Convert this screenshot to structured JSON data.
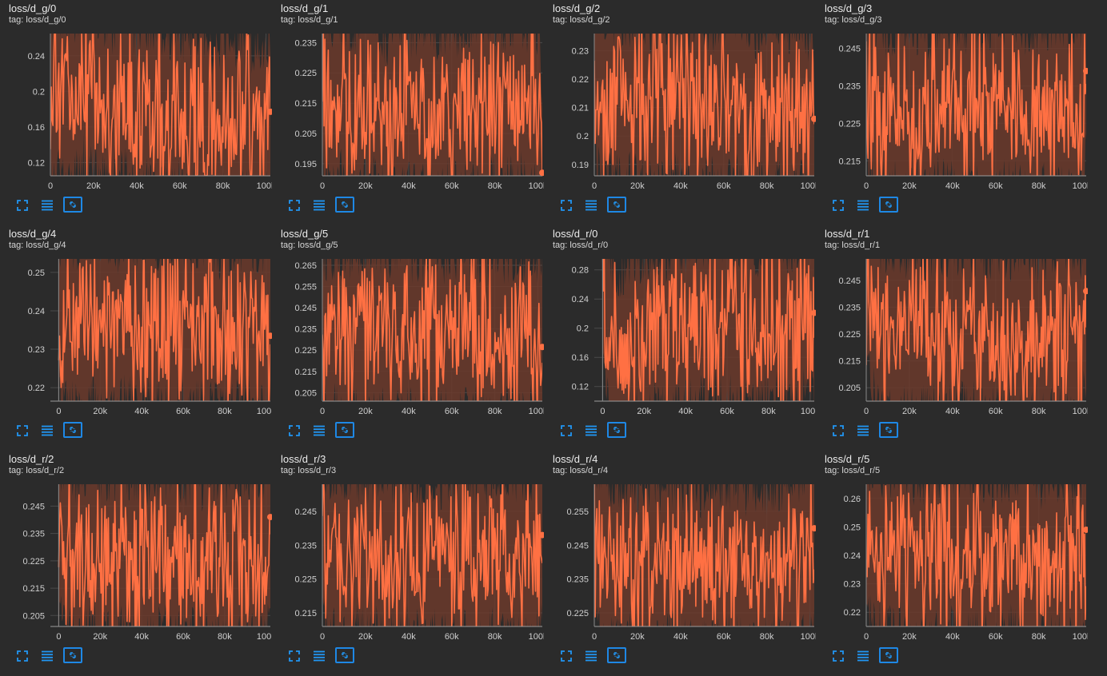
{
  "colors": {
    "background": "#2b2b2b",
    "series": "#ff7043",
    "band": "#6b3a2c",
    "grid": "#4a4a4a",
    "axis": "#9e9e9e",
    "toolbar": "#2196f3"
  },
  "toolbar_icons": [
    "fullscreen-icon",
    "toggle-log-scale-icon",
    "fit-domain-icon"
  ],
  "chart_data": [
    {
      "title": "loss/d_g/0",
      "tag": "tag: loss/d_g/0",
      "type": "line",
      "xlim": [
        0,
        102000
      ],
      "ylim": [
        0.105,
        0.265
      ],
      "xticks": [
        0,
        20000,
        40000,
        60000,
        80000,
        100000
      ],
      "xticklabels": [
        "0",
        "20k",
        "40k",
        "60k",
        "80k",
        "100k"
      ],
      "yticks": [
        0.12,
        0.16,
        0.2,
        0.24
      ],
      "yticklabels": [
        "0.12",
        "0.16",
        "0.2",
        "0.24"
      ],
      "series": [
        {
          "x": [
            0,
            5000,
            10000,
            15000,
            20000,
            25000,
            30000,
            35000,
            40000,
            45000,
            50000,
            55000,
            60000,
            65000,
            70000,
            75000,
            80000,
            85000,
            90000,
            95000,
            100000,
            102000
          ],
          "y": [
            0.18,
            0.2,
            0.19,
            0.21,
            0.2,
            0.19,
            0.18,
            0.2,
            0.17,
            0.19,
            0.18,
            0.17,
            0.18,
            0.17,
            0.18,
            0.16,
            0.17,
            0.16,
            0.17,
            0.16,
            0.17,
            0.177
          ]
        }
      ]
    },
    {
      "title": "loss/d_g/1",
      "tag": "tag: loss/d_g/1",
      "type": "line",
      "xlim": [
        0,
        102000
      ],
      "ylim": [
        0.191,
        0.238
      ],
      "xticks": [
        0,
        20000,
        40000,
        60000,
        80000,
        100000
      ],
      "xticklabels": [
        "0",
        "20k",
        "40k",
        "60k",
        "80k",
        "100k"
      ],
      "yticks": [
        0.195,
        0.205,
        0.215,
        0.225,
        0.235
      ],
      "yticklabels": [
        "0.195",
        "0.205",
        "0.215",
        "0.225",
        "0.235"
      ],
      "series": [
        {
          "x": [
            0,
            5000,
            10000,
            15000,
            20000,
            25000,
            30000,
            35000,
            40000,
            45000,
            50000,
            55000,
            60000,
            65000,
            70000,
            75000,
            80000,
            85000,
            90000,
            95000,
            100000,
            102000
          ],
          "y": [
            0.22,
            0.215,
            0.218,
            0.212,
            0.216,
            0.214,
            0.21,
            0.215,
            0.212,
            0.214,
            0.211,
            0.213,
            0.214,
            0.212,
            0.215,
            0.213,
            0.216,
            0.214,
            0.217,
            0.215,
            0.213,
            0.192
          ]
        }
      ]
    },
    {
      "title": "loss/d_g/2",
      "tag": "tag: loss/d_g/2",
      "type": "line",
      "xlim": [
        0,
        102000
      ],
      "ylim": [
        0.186,
        0.236
      ],
      "xticks": [
        0,
        20000,
        40000,
        60000,
        80000,
        100000
      ],
      "xticklabels": [
        "0",
        "20k",
        "40k",
        "60k",
        "80k",
        "100k"
      ],
      "yticks": [
        0.19,
        0.2,
        0.21,
        0.22,
        0.23
      ],
      "yticklabels": [
        "0.19",
        "0.2",
        "0.21",
        "0.22",
        "0.23"
      ],
      "series": [
        {
          "x": [
            0,
            5000,
            10000,
            15000,
            20000,
            25000,
            30000,
            35000,
            40000,
            45000,
            50000,
            55000,
            60000,
            65000,
            70000,
            75000,
            80000,
            85000,
            90000,
            95000,
            100000,
            102000
          ],
          "y": [
            0.22,
            0.215,
            0.214,
            0.212,
            0.213,
            0.21,
            0.212,
            0.211,
            0.213,
            0.21,
            0.212,
            0.211,
            0.21,
            0.213,
            0.21,
            0.209,
            0.212,
            0.21,
            0.209,
            0.211,
            0.208,
            0.206
          ]
        }
      ]
    },
    {
      "title": "loss/d_g/3",
      "tag": "tag: loss/d_g/3",
      "type": "line",
      "xlim": [
        0,
        102000
      ],
      "ylim": [
        0.211,
        0.249
      ],
      "xticks": [
        0,
        20000,
        40000,
        60000,
        80000,
        100000
      ],
      "xticklabels": [
        "0",
        "20k",
        "40k",
        "60k",
        "80k",
        "100k"
      ],
      "yticks": [
        0.215,
        0.225,
        0.235,
        0.245
      ],
      "yticklabels": [
        "0.215",
        "0.225",
        "0.235",
        "0.245"
      ],
      "series": [
        {
          "x": [
            0,
            5000,
            10000,
            15000,
            20000,
            25000,
            30000,
            35000,
            40000,
            45000,
            50000,
            55000,
            60000,
            65000,
            70000,
            75000,
            80000,
            85000,
            90000,
            95000,
            100000,
            102000
          ],
          "y": [
            0.232,
            0.23,
            0.228,
            0.231,
            0.229,
            0.23,
            0.228,
            0.232,
            0.23,
            0.229,
            0.231,
            0.228,
            0.23,
            0.229,
            0.23,
            0.227,
            0.229,
            0.228,
            0.229,
            0.228,
            0.231,
            0.239
          ]
        }
      ]
    },
    {
      "title": "loss/d_g/4",
      "tag": "tag: loss/d_g/4",
      "type": "line",
      "xlim": [
        -4000,
        102000
      ],
      "ylim": [
        0.2165,
        0.2535
      ],
      "xticks": [
        0,
        20000,
        40000,
        60000,
        80000,
        100000
      ],
      "xticklabels": [
        "0",
        "20k",
        "40k",
        "60k",
        "80k",
        "100k"
      ],
      "yticks": [
        0.22,
        0.23,
        0.24,
        0.25
      ],
      "yticklabels": [
        "0.22",
        "0.23",
        "0.24",
        "0.25"
      ],
      "series": [
        {
          "x": [
            0,
            5000,
            10000,
            15000,
            20000,
            25000,
            30000,
            35000,
            40000,
            45000,
            50000,
            55000,
            60000,
            65000,
            70000,
            75000,
            80000,
            85000,
            90000,
            95000,
            100000,
            102000
          ],
          "y": [
            0.237,
            0.238,
            0.236,
            0.239,
            0.235,
            0.237,
            0.236,
            0.238,
            0.235,
            0.237,
            0.236,
            0.234,
            0.236,
            0.235,
            0.237,
            0.236,
            0.234,
            0.236,
            0.237,
            0.235,
            0.236,
            0.2335
          ]
        }
      ]
    },
    {
      "title": "loss/d_g/5",
      "tag": "tag: loss/d_g/5",
      "type": "line",
      "xlim": [
        0,
        102000
      ],
      "ylim": [
        0.201,
        0.268
      ],
      "xticks": [
        0,
        20000,
        40000,
        60000,
        80000,
        100000
      ],
      "xticklabels": [
        "0",
        "20k",
        "40k",
        "60k",
        "80k",
        "100k"
      ],
      "yticks": [
        0.205,
        0.215,
        0.225,
        0.235,
        0.245,
        0.255,
        0.265
      ],
      "yticklabels": [
        "0.205",
        "0.215",
        "0.225",
        "0.235",
        "0.245",
        "0.255",
        "0.265"
      ],
      "series": [
        {
          "x": [
            0,
            5000,
            10000,
            15000,
            20000,
            25000,
            30000,
            35000,
            40000,
            45000,
            50000,
            55000,
            60000,
            65000,
            70000,
            75000,
            80000,
            85000,
            90000,
            95000,
            100000,
            102000
          ],
          "y": [
            0.232,
            0.234,
            0.23,
            0.233,
            0.231,
            0.234,
            0.232,
            0.236,
            0.233,
            0.232,
            0.235,
            0.231,
            0.233,
            0.232,
            0.234,
            0.231,
            0.233,
            0.232,
            0.231,
            0.233,
            0.232,
            0.2265
          ]
        }
      ]
    },
    {
      "title": "loss/d_r/0",
      "tag": "tag: loss/d_r/0",
      "type": "line",
      "xlim": [
        -4000,
        102000
      ],
      "ylim": [
        0.1,
        0.295
      ],
      "xticks": [
        0,
        20000,
        40000,
        60000,
        80000,
        100000
      ],
      "xticklabels": [
        "0",
        "20k",
        "40k",
        "60k",
        "80k",
        "100k"
      ],
      "yticks": [
        0.12,
        0.16,
        0.2,
        0.24,
        0.28
      ],
      "yticklabels": [
        "0.12",
        "0.16",
        "0.2",
        "0.24",
        "0.28"
      ],
      "series": [
        {
          "x": [
            0,
            5000,
            10000,
            15000,
            20000,
            25000,
            30000,
            35000,
            40000,
            45000,
            50000,
            55000,
            60000,
            65000,
            70000,
            75000,
            80000,
            85000,
            90000,
            95000,
            100000,
            102000
          ],
          "y": [
            0.25,
            0.18,
            0.17,
            0.19,
            0.18,
            0.2,
            0.19,
            0.21,
            0.2,
            0.21,
            0.2,
            0.22,
            0.21,
            0.2,
            0.21,
            0.2,
            0.22,
            0.21,
            0.2,
            0.21,
            0.22,
            0.221
          ]
        }
      ]
    },
    {
      "title": "loss/d_r/1",
      "tag": "tag: loss/d_r/1",
      "type": "line",
      "xlim": [
        0,
        102000
      ],
      "ylim": [
        0.2,
        0.253
      ],
      "xticks": [
        0,
        20000,
        40000,
        60000,
        80000,
        100000
      ],
      "xticklabels": [
        "0",
        "20k",
        "40k",
        "60k",
        "80k",
        "100k"
      ],
      "yticks": [
        0.205,
        0.215,
        0.225,
        0.235,
        0.245
      ],
      "yticklabels": [
        "0.205",
        "0.215",
        "0.225",
        "0.235",
        "0.245"
      ],
      "series": [
        {
          "x": [
            0,
            5000,
            10000,
            15000,
            20000,
            25000,
            30000,
            35000,
            40000,
            45000,
            50000,
            55000,
            60000,
            65000,
            70000,
            75000,
            80000,
            85000,
            90000,
            95000,
            100000,
            102000
          ],
          "y": [
            0.24,
            0.228,
            0.225,
            0.228,
            0.226,
            0.224,
            0.227,
            0.225,
            0.228,
            0.226,
            0.227,
            0.225,
            0.226,
            0.224,
            0.227,
            0.225,
            0.223,
            0.226,
            0.225,
            0.224,
            0.226,
            0.241
          ]
        }
      ]
    },
    {
      "title": "loss/d_r/2",
      "tag": "tag: loss/d_r/2",
      "type": "line",
      "xlim": [
        -4000,
        102000
      ],
      "ylim": [
        0.201,
        0.253
      ],
      "xticks": [
        0,
        20000,
        40000,
        60000,
        80000,
        100000
      ],
      "xticklabels": [
        "0",
        "20k",
        "40k",
        "60k",
        "80k",
        "100k"
      ],
      "yticks": [
        0.205,
        0.215,
        0.225,
        0.235,
        0.245
      ],
      "yticklabels": [
        "0.205",
        "0.215",
        "0.225",
        "0.235",
        "0.245"
      ],
      "series": [
        {
          "x": [
            0,
            5000,
            10000,
            15000,
            20000,
            25000,
            30000,
            35000,
            40000,
            45000,
            50000,
            55000,
            60000,
            65000,
            70000,
            75000,
            80000,
            85000,
            90000,
            95000,
            100000,
            102000
          ],
          "y": [
            0.232,
            0.228,
            0.226,
            0.229,
            0.227,
            0.225,
            0.228,
            0.226,
            0.227,
            0.225,
            0.228,
            0.226,
            0.225,
            0.227,
            0.224,
            0.226,
            0.225,
            0.223,
            0.226,
            0.224,
            0.225,
            0.241
          ]
        }
      ]
    },
    {
      "title": "loss/d_r/3",
      "tag": "tag: loss/d_r/3",
      "type": "line",
      "xlim": [
        0,
        102000
      ],
      "ylim": [
        0.211,
        0.253
      ],
      "xticks": [
        0,
        20000,
        40000,
        60000,
        80000,
        100000
      ],
      "xticklabels": [
        "0",
        "20k",
        "40k",
        "60k",
        "80k",
        "100k"
      ],
      "yticks": [
        0.215,
        0.225,
        0.235,
        0.245
      ],
      "yticklabels": [
        "0.215",
        "0.225",
        "0.235",
        "0.245"
      ],
      "series": [
        {
          "x": [
            0,
            5000,
            10000,
            15000,
            20000,
            25000,
            30000,
            35000,
            40000,
            45000,
            50000,
            55000,
            60000,
            65000,
            70000,
            75000,
            80000,
            85000,
            90000,
            95000,
            100000,
            102000
          ],
          "y": [
            0.236,
            0.232,
            0.231,
            0.233,
            0.231,
            0.232,
            0.23,
            0.232,
            0.233,
            0.231,
            0.232,
            0.23,
            0.231,
            0.232,
            0.23,
            0.231,
            0.232,
            0.23,
            0.231,
            0.232,
            0.231,
            0.238
          ]
        }
      ]
    },
    {
      "title": "loss/d_r/4",
      "tag": "tag: loss/d_r/4",
      "type": "line",
      "xlim": [
        0,
        102000
      ],
      "ylim": [
        0.221,
        0.263
      ],
      "xticks": [
        0,
        20000,
        40000,
        60000,
        80000,
        100000
      ],
      "xticklabels": [
        "0",
        "20k",
        "40k",
        "60k",
        "80k",
        "100k"
      ],
      "yticks": [
        0.225,
        0.235,
        0.245,
        0.255
      ],
      "yticklabels": [
        "0.225",
        "0.235",
        "0.245",
        "0.255"
      ],
      "series": [
        {
          "x": [
            0,
            5000,
            10000,
            15000,
            20000,
            25000,
            30000,
            35000,
            40000,
            45000,
            50000,
            55000,
            60000,
            65000,
            70000,
            75000,
            80000,
            85000,
            90000,
            95000,
            100000,
            102000
          ],
          "y": [
            0.243,
            0.24,
            0.238,
            0.241,
            0.239,
            0.24,
            0.238,
            0.241,
            0.239,
            0.24,
            0.238,
            0.24,
            0.239,
            0.241,
            0.238,
            0.24,
            0.239,
            0.24,
            0.238,
            0.24,
            0.241,
            0.25
          ]
        }
      ]
    },
    {
      "title": "loss/d_r/5",
      "tag": "tag: loss/d_r/5",
      "type": "line",
      "xlim": [
        0,
        102000
      ],
      "ylim": [
        0.215,
        0.265
      ],
      "xticks": [
        0,
        20000,
        40000,
        60000,
        80000,
        100000
      ],
      "xticklabels": [
        "0",
        "20k",
        "40k",
        "60k",
        "80k",
        "100k"
      ],
      "yticks": [
        0.22,
        0.23,
        0.24,
        0.25,
        0.26
      ],
      "yticklabels": [
        "0.22",
        "0.23",
        "0.24",
        "0.25",
        "0.26"
      ],
      "series": [
        {
          "x": [
            0,
            5000,
            10000,
            15000,
            20000,
            25000,
            30000,
            35000,
            40000,
            45000,
            50000,
            55000,
            60000,
            65000,
            70000,
            75000,
            80000,
            85000,
            90000,
            95000,
            100000,
            102000
          ],
          "y": [
            0.245,
            0.242,
            0.24,
            0.243,
            0.24,
            0.238,
            0.241,
            0.239,
            0.24,
            0.238,
            0.241,
            0.239,
            0.238,
            0.24,
            0.242,
            0.239,
            0.237,
            0.24,
            0.238,
            0.236,
            0.239,
            0.249
          ]
        }
      ]
    }
  ]
}
